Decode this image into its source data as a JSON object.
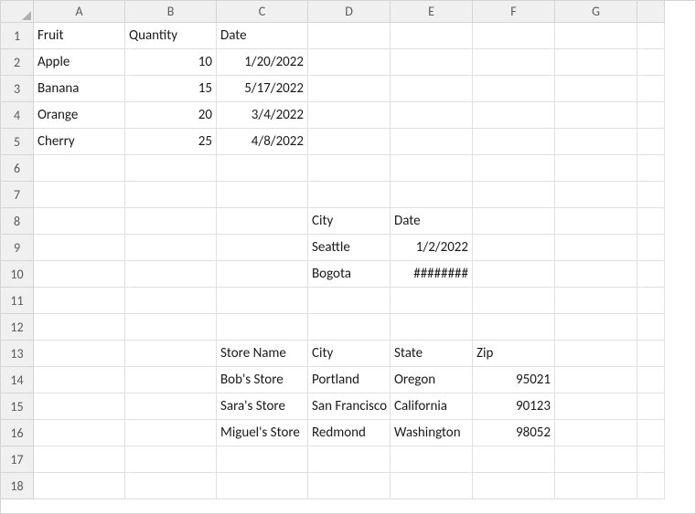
{
  "columns": [
    "A",
    "B",
    "C",
    "D",
    "E",
    "F",
    "G"
  ],
  "rows": 18,
  "cells": {
    "A1": {
      "v": "Fruit",
      "align": "left"
    },
    "B1": {
      "v": "Quantity",
      "align": "left"
    },
    "C1": {
      "v": "Date",
      "align": "left"
    },
    "A2": {
      "v": "Apple",
      "align": "left"
    },
    "B2": {
      "v": "10",
      "align": "right"
    },
    "C2": {
      "v": "1/20/2022",
      "align": "right"
    },
    "A3": {
      "v": "Banana",
      "align": "left"
    },
    "B3": {
      "v": "15",
      "align": "right"
    },
    "C3": {
      "v": "5/17/2022",
      "align": "right"
    },
    "A4": {
      "v": "Orange",
      "align": "left"
    },
    "B4": {
      "v": "20",
      "align": "right"
    },
    "C4": {
      "v": "3/4/2022",
      "align": "right"
    },
    "A5": {
      "v": "Cherry",
      "align": "left"
    },
    "B5": {
      "v": "25",
      "align": "right"
    },
    "C5": {
      "v": "4/8/2022",
      "align": "right"
    },
    "D8": {
      "v": "City",
      "align": "left"
    },
    "E8": {
      "v": "Date",
      "align": "left"
    },
    "D9": {
      "v": "Seattle",
      "align": "left"
    },
    "E9": {
      "v": "1/2/2022",
      "align": "right"
    },
    "D10": {
      "v": "Bogota",
      "align": "left"
    },
    "E10": {
      "v": "########",
      "align": "right"
    },
    "C13": {
      "v": "Store Name",
      "align": "left"
    },
    "D13": {
      "v": "City",
      "align": "left"
    },
    "E13": {
      "v": "State",
      "align": "left"
    },
    "F13": {
      "v": "Zip",
      "align": "left"
    },
    "C14": {
      "v": "Bob's Store",
      "align": "left"
    },
    "D14": {
      "v": "Portland",
      "align": "left"
    },
    "E14": {
      "v": "Oregon",
      "align": "left"
    },
    "F14": {
      "v": "95021",
      "align": "right"
    },
    "C15": {
      "v": "Sara's Store",
      "align": "left"
    },
    "D15": {
      "v": "San Francisco",
      "align": "left"
    },
    "E15": {
      "v": "California",
      "align": "left"
    },
    "F15": {
      "v": "90123",
      "align": "right"
    },
    "C16": {
      "v": "Miguel's Store",
      "align": "left"
    },
    "D16": {
      "v": "Redmond",
      "align": "left"
    },
    "E16": {
      "v": "Washington",
      "align": "left"
    },
    "F16": {
      "v": "98052",
      "align": "right"
    }
  }
}
